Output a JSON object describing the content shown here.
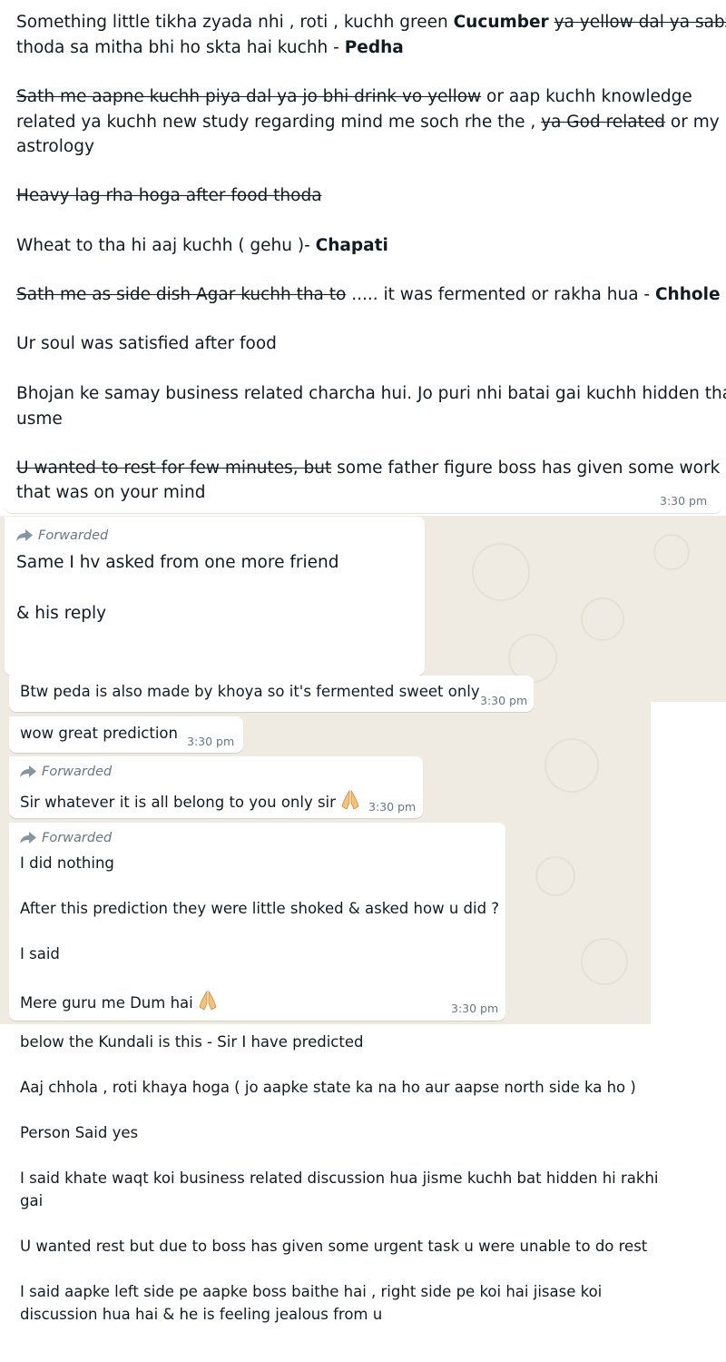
{
  "top": {
    "l1a": "Something little tikha zyada nhi , roti , kuchh green ",
    "l1b": "Cucumber",
    "l1c": " ",
    "l1d": "ya yellow dal ya  sabzi",
    "l2a": "thoda sa mitha bhi ho skta hai kuchh - ",
    "l2b": "Pedha",
    "l3a": "Sath me aapne kuchh piya dal ya jo bhi drink vo yellow",
    "l3b": " or aap kuchh knowledge",
    "l4a": "related ya kuchh new study regarding mind me soch rhe the , ",
    "l4b": "ya God related",
    "l4c": " or my",
    "l5": "astrology",
    "l6": "Heavy lag rha hoga after food thoda",
    "l7a": "Wheat to tha hi aaj kuchh ( gehu )- ",
    "l7b": "Chapati",
    "l8a": "Sath me as side dish Agar kuchh tha to",
    "l8b": " ..... it was fermented or rakha hua - ",
    "l8c": "Chhole",
    "l9": "Ur soul was satisfied after food",
    "l10": "Bhojan ke samay business related charcha hui. Jo puri nhi batai gai kuchh hidden tha",
    "l11": "usme",
    "l12a": "U wanted to rest for few minutes,  but",
    "l12b": " some father figure boss has given some work",
    "l13": "that was on your mind",
    "time": "3:30 pm"
  },
  "forwarded_label": "Forwarded",
  "msg_friend": {
    "line1": "Same I hv asked from one more friend",
    "line2": "& his reply"
  },
  "msg_peda": {
    "text": "Btw peda is also made by khoya so it's fermented sweet only",
    "time": "3:30 pm"
  },
  "msg_wow": {
    "text": "wow great prediction",
    "time": "3:30 pm"
  },
  "msg_sir": {
    "text": "Sir whatever it is all belong to you only sir",
    "time": "3:30 pm"
  },
  "msg_nothing": {
    "l1": "I did nothing",
    "l2": "After this prediction they were little shoked & asked how u did ?",
    "l3": "I said",
    "l4": "Mere guru me Dum hai",
    "time": "3:30 pm"
  },
  "bottom": {
    "l1": "below the Kundali is this - Sir I have predicted",
    "l2": "Aaj chhola , roti khaya hoga ( jo aapke state ka na ho aur aapse north side ka ho )",
    "l3": "Person Said yes",
    "l4": "I said khate waqt koi business related discussion hua jisme kuchh bat hidden hi rakhi",
    "l5": "gai",
    "l6": "U wanted rest but due to boss has given some urgent task u were unable to do rest",
    "l7": "I said aapke left side pe aapke boss baithe hai , right side pe koi hai jisase koi",
    "l8": "discussion hua hai & he is feeling jealous from u"
  },
  "icons": {
    "forward": "forward-arrow-icon",
    "pray": "folded-hands-icon"
  },
  "colors": {
    "chat_bg": "#efeae2",
    "bubble": "#ffffff",
    "meta": "#667781",
    "text": "#111b21"
  }
}
